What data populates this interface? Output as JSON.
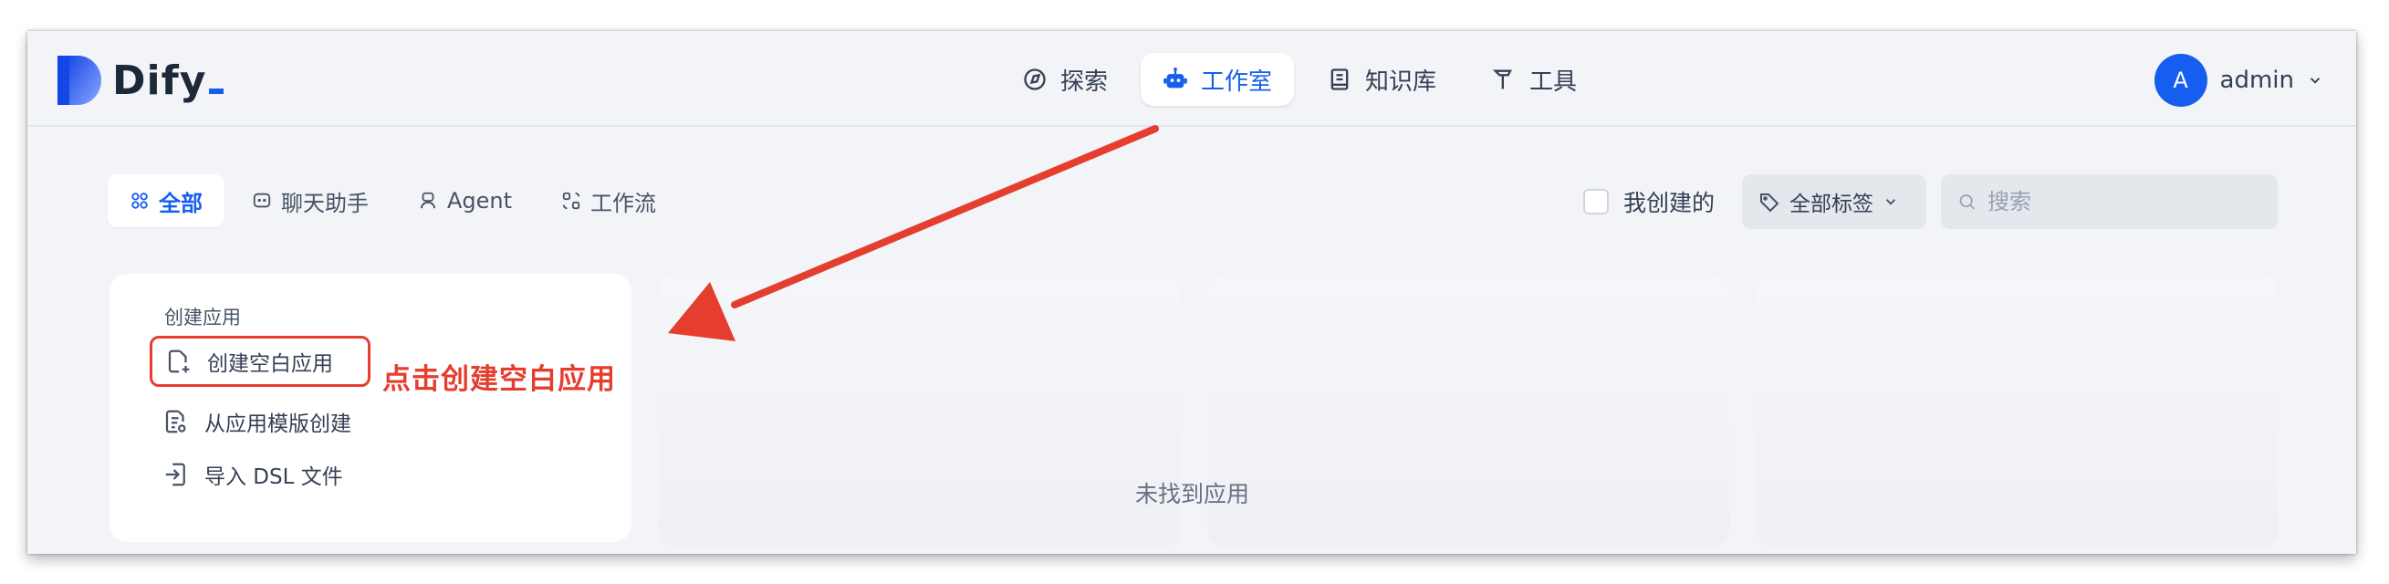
{
  "brand": {
    "name": "Dify",
    "accent": "#155eef"
  },
  "nav": {
    "items": [
      {
        "label": "探索",
        "icon": "compass-icon"
      },
      {
        "label": "工作室",
        "icon": "robot-icon",
        "active": true
      },
      {
        "label": "知识库",
        "icon": "book-icon"
      },
      {
        "label": "工具",
        "icon": "hammer-icon"
      }
    ]
  },
  "user": {
    "initial": "A",
    "name": "admin"
  },
  "filters": {
    "tabs": [
      {
        "label": "全部",
        "icon": "grid-icon",
        "active": true
      },
      {
        "label": "聊天助手",
        "icon": "chat-bubble-icon"
      },
      {
        "label": "Agent",
        "icon": "agent-icon"
      },
      {
        "label": "工作流",
        "icon": "workflow-icon"
      }
    ],
    "mine_label": "我创建的",
    "mine_checked": false,
    "tag_select_label": "全部标签",
    "search_placeholder": "搜索"
  },
  "create": {
    "title": "创建应用",
    "items": [
      {
        "label": "创建空白应用",
        "icon": "new-file-icon"
      },
      {
        "label": "从应用模版创建",
        "icon": "template-icon"
      },
      {
        "label": "导入 DSL 文件",
        "icon": "import-icon"
      }
    ]
  },
  "annotation": {
    "text": "点击创建空白应用",
    "color": "#e53e2f"
  },
  "empty_state": "未找到应用"
}
